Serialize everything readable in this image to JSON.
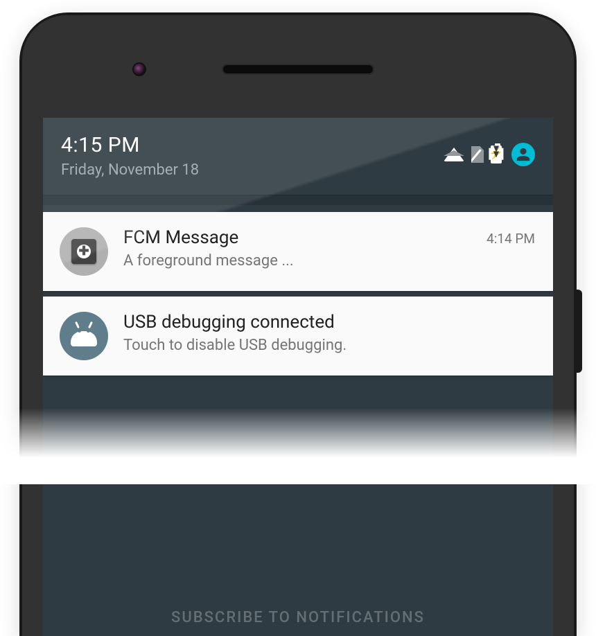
{
  "header": {
    "time": "4:15 PM",
    "date": "Friday, November 18"
  },
  "status_icons": {
    "wifi": "wifi-icon",
    "sim": "no-sim-icon",
    "battery": "battery-charging-icon",
    "profile": "profile-avatar-icon"
  },
  "notifications": [
    {
      "icon": "app-fcm-icon",
      "title": "FCM Message",
      "subtitle": "A foreground message ...",
      "time": "4:14 PM"
    },
    {
      "icon": "android-system-icon",
      "title": "USB debugging connected",
      "subtitle": "Touch to disable USB debugging.",
      "time": ""
    }
  ],
  "footer": {
    "subscribe_label": "SUBSCRIBE TO NOTIFICATIONS"
  }
}
